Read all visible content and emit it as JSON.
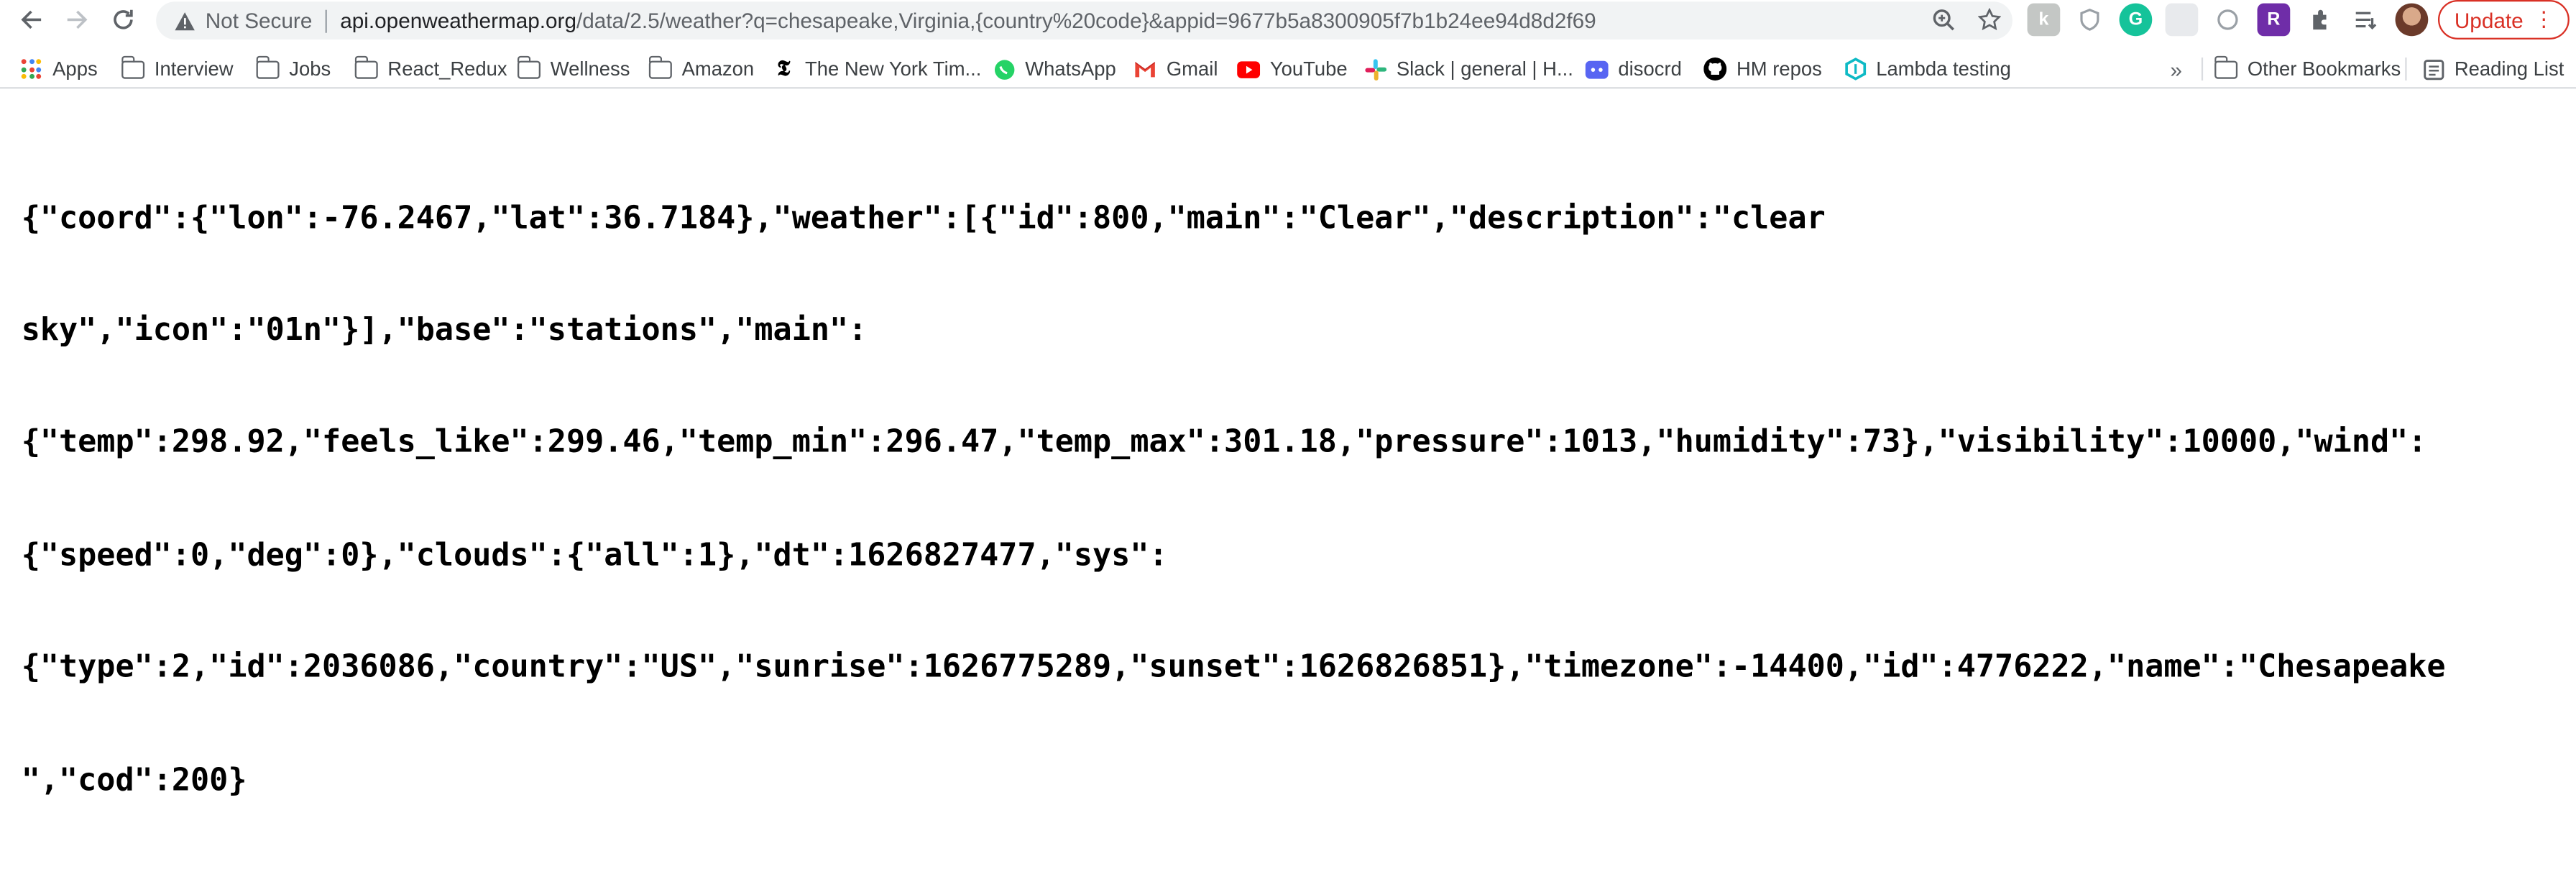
{
  "toolbar": {
    "back_icon": "arrow-left-icon",
    "forward_icon": "arrow-right-icon",
    "reload_icon": "reload-icon",
    "security_label": "Not Secure",
    "url_host": "api.openweathermap.org",
    "url_path": "/data/2.5/weather?q=chesapeake,Virginia,{country%20code}&appid=9677b5a8300905f7b1b24ee94d8d2f69",
    "update_label": "Update"
  },
  "bookmarks": {
    "items": [
      {
        "label": "Apps",
        "icon": "apps-grid-icon"
      },
      {
        "label": "Interview",
        "icon": "folder-icon"
      },
      {
        "label": "Jobs",
        "icon": "folder-icon"
      },
      {
        "label": "React_Redux",
        "icon": "folder-icon"
      },
      {
        "label": "Wellness",
        "icon": "folder-icon"
      },
      {
        "label": "Amazon",
        "icon": "folder-icon"
      },
      {
        "label": "The New York Tim...",
        "icon": "nyt-icon"
      },
      {
        "label": "WhatsApp",
        "icon": "whatsapp-icon"
      },
      {
        "label": "Gmail",
        "icon": "gmail-icon"
      },
      {
        "label": "YouTube",
        "icon": "youtube-icon"
      },
      {
        "label": "Slack | general | H...",
        "icon": "slack-icon"
      },
      {
        "label": "disocrd",
        "icon": "discord-icon"
      },
      {
        "label": "HM repos",
        "icon": "github-icon"
      },
      {
        "label": "Lambda testing",
        "icon": "lambda-icon"
      }
    ],
    "overflow": "»",
    "other_bookmarks": "Other Bookmarks",
    "reading_list": "Reading List"
  },
  "content": {
    "json_text": "{\"coord\":{\"lon\":-76.2467,\"lat\":36.7184},\"weather\":[{\"id\":800,\"main\":\"Clear\",\"description\":\"clear sky\",\"icon\":\"01n\"}],\"base\":\"stations\",\"main\":{\"temp\":298.92,\"feels_like\":299.46,\"temp_min\":296.47,\"temp_max\":301.18,\"pressure\":1013,\"humidity\":73},\"visibility\":10000,\"wind\":{\"speed\":0,\"deg\":0},\"clouds\":{\"all\":1},\"dt\":1626827477,\"sys\":{\"type\":2,\"id\":2036086,\"country\":\"US\",\"sunrise\":1626775289,\"sunset\":1626826851},\"timezone\":-14400,\"id\":4776222,\"name\":\"Chesapeake\",\"cod\":200}",
    "lines": [
      "{\"coord\":{\"lon\":-76.2467,\"lat\":36.7184},\"weather\":[{\"id\":800,\"main\":\"Clear\",\"description\":\"clear",
      "sky\",\"icon\":\"01n\"}],\"base\":\"stations\",\"main\":",
      "{\"temp\":298.92,\"feels_like\":299.46,\"temp_min\":296.47,\"temp_max\":301.18,\"pressure\":1013,\"humidity\":73},\"visibility\":10000,\"wind\":",
      "{\"speed\":0,\"deg\":0},\"clouds\":{\"all\":1},\"dt\":1626827477,\"sys\":",
      "{\"type\":2,\"id\":2036086,\"country\":\"US\",\"sunrise\":1626775289,\"sunset\":1626826851},\"timezone\":-14400,\"id\":4776222,\"name\":\"Chesapeake",
      "\",\"cod\":200}"
    ]
  }
}
